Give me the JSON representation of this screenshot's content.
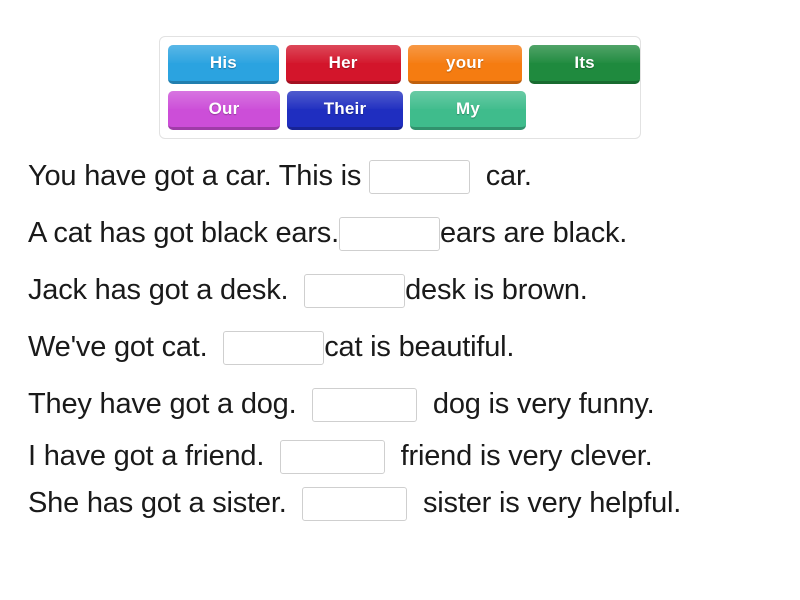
{
  "wordbank": {
    "rows": [
      [
        {
          "label": "His",
          "color": "#2ba3e0",
          "name": "his"
        },
        {
          "label": "Her",
          "color": "#d3152b",
          "name": "her"
        },
        {
          "label": "your",
          "color": "#f57c11",
          "name": "your"
        },
        {
          "label": "Its",
          "color": "#1f8a3e",
          "name": "its"
        }
      ],
      [
        {
          "label": "Our",
          "color": "#cc4ed8",
          "name": "our"
        },
        {
          "label": "Their",
          "color": "#1f2ec0",
          "name": "their"
        },
        {
          "label": "My",
          "color": "#3fbc8c",
          "name": "my"
        }
      ]
    ]
  },
  "sentences": [
    {
      "before": "You have got a car. This is ",
      "after": "  car.",
      "tight": false
    },
    {
      "before": "A cat has got black ears.",
      "after": "ears are black.",
      "tight": false
    },
    {
      "before": "Jack has got a desk.  ",
      "after": "desk is brown.",
      "tight": false
    },
    {
      "before": "We've got cat.  ",
      "after": "cat is beautiful.",
      "tight": false
    },
    {
      "before": "They have got a dog.  ",
      "after": "  dog is very funny.",
      "tight": false
    },
    {
      "before": "I have got a friend.  ",
      "after": "  friend is very clever.",
      "tight": true
    },
    {
      "before": "She has got a sister.  ",
      "after": "  sister is very helpful.",
      "tight": true
    }
  ]
}
